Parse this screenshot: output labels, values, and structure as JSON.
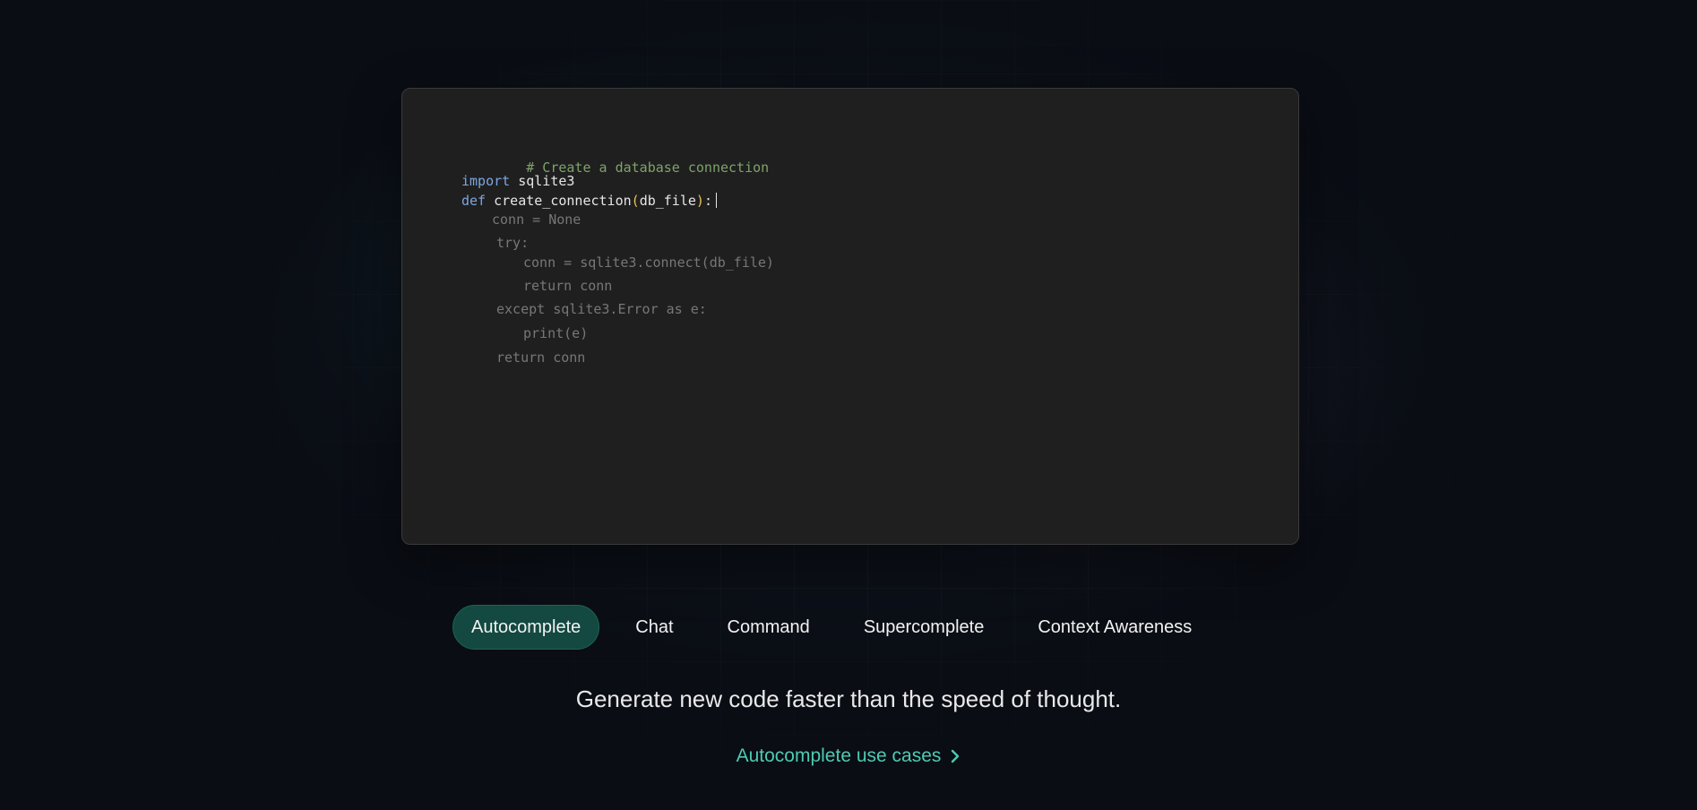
{
  "code": {
    "comment": "# Create a database connection",
    "import_keyword": "import",
    "import_module": " sqlite3",
    "def_keyword": "def",
    "func_name": " create_connection",
    "paren_open": "(",
    "param": "db_file",
    "paren_close": ")",
    "colon": ":",
    "ghost_lines": [
      "conn = None",
      "try:",
      "conn = sqlite3.connect(db_file)",
      "return conn",
      "except sqlite3.Error as e:",
      "print(e)",
      "return conn"
    ]
  },
  "tabs": [
    {
      "label": "Autocomplete",
      "active": true
    },
    {
      "label": "Chat",
      "active": false
    },
    {
      "label": "Command",
      "active": false
    },
    {
      "label": "Supercomplete",
      "active": false
    },
    {
      "label": "Context Awareness",
      "active": false
    }
  ],
  "tagline": "Generate new code faster than the speed of thought.",
  "cta": {
    "label": "Autocomplete use cases",
    "icon": "chevron-right-icon"
  },
  "colors": {
    "accent": "#4ecbb2",
    "active_tab_bg": "#134941",
    "editor_bg": "#1f1f1f",
    "page_bg": "#0a0d14"
  }
}
